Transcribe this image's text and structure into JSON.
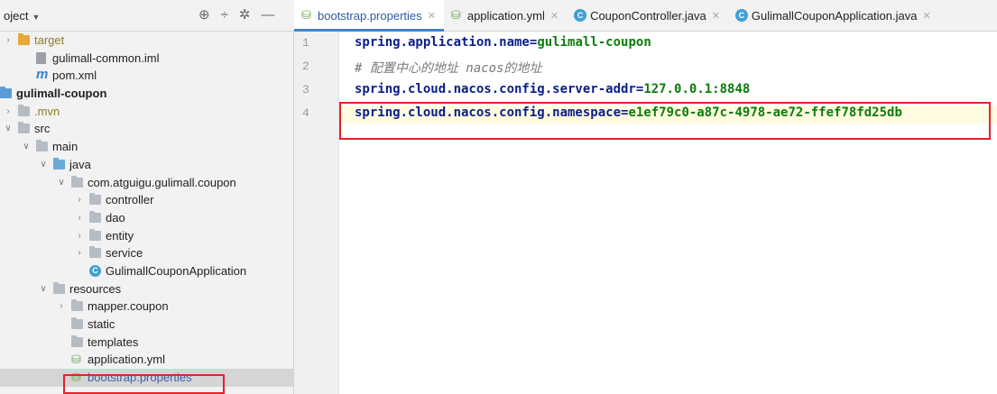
{
  "project_panel": {
    "title": "oject",
    "tree": [
      {
        "label": "target",
        "kind": "folder-orange",
        "depth": 0,
        "arrow": "right",
        "style": "olive"
      },
      {
        "label": "gulimall-common.iml",
        "kind": "iml",
        "depth": 1,
        "arrow": "",
        "style": ""
      },
      {
        "label": "pom.xml",
        "kind": "maven",
        "depth": 1,
        "arrow": "",
        "style": ""
      },
      {
        "label": "gulimall-coupon",
        "kind": "module",
        "depth": 0,
        "arrow": "",
        "style": "bold"
      },
      {
        "label": ".mvn",
        "kind": "folder-grey",
        "depth": 0,
        "arrow": "right",
        "style": "olive"
      },
      {
        "label": "src",
        "kind": "folder-grey",
        "depth": 0,
        "arrow": "down",
        "style": ""
      },
      {
        "label": "main",
        "kind": "folder-grey",
        "depth": 1,
        "arrow": "down",
        "style": ""
      },
      {
        "label": "java",
        "kind": "folder-blue",
        "depth": 2,
        "arrow": "down",
        "style": ""
      },
      {
        "label": "com.atguigu.gulimall.coupon",
        "kind": "folder-grey",
        "depth": 3,
        "arrow": "down",
        "style": ""
      },
      {
        "label": "controller",
        "kind": "folder-grey",
        "depth": 4,
        "arrow": "right",
        "style": ""
      },
      {
        "label": "dao",
        "kind": "folder-grey",
        "depth": 4,
        "arrow": "right",
        "style": ""
      },
      {
        "label": "entity",
        "kind": "folder-grey",
        "depth": 4,
        "arrow": "right",
        "style": ""
      },
      {
        "label": "service",
        "kind": "folder-grey",
        "depth": 4,
        "arrow": "right",
        "style": ""
      },
      {
        "label": "GulimallCouponApplication",
        "kind": "spring-class",
        "depth": 4,
        "arrow": "",
        "style": ""
      },
      {
        "label": "resources",
        "kind": "folder-grey",
        "depth": 2,
        "arrow": "down",
        "style": ""
      },
      {
        "label": "mapper.coupon",
        "kind": "folder-grey",
        "depth": 3,
        "arrow": "right",
        "style": ""
      },
      {
        "label": "static",
        "kind": "folder-grey",
        "depth": 3,
        "arrow": "",
        "style": ""
      },
      {
        "label": "templates",
        "kind": "folder-grey",
        "depth": 3,
        "arrow": "",
        "style": ""
      },
      {
        "label": "application.yml",
        "kind": "yml",
        "depth": 3,
        "arrow": "",
        "style": ""
      },
      {
        "label": "bootstrap.properties",
        "kind": "properties",
        "depth": 3,
        "arrow": "",
        "style": "blue",
        "selected": true
      }
    ]
  },
  "tabs": [
    {
      "label": "bootstrap.properties",
      "icon": "properties-icon",
      "active": true
    },
    {
      "label": "application.yml",
      "icon": "yml-icon",
      "active": false
    },
    {
      "label": "CouponController.java",
      "icon": "class-icon",
      "active": false
    },
    {
      "label": "GulimallCouponApplication.java",
      "icon": "spring-class-icon",
      "active": false
    }
  ],
  "editor": {
    "lines": [
      {
        "number": "1",
        "key": "spring.application.name",
        "eq": "=",
        "value": "gulimall-coupon",
        "comment": ""
      },
      {
        "number": "2",
        "key": "",
        "eq": "",
        "value": "",
        "comment": "# 配置中心的地址 nacos的地址"
      },
      {
        "number": "3",
        "key": "spring.cloud.nacos.config.server-addr",
        "eq": "=",
        "value": "127.0.0.1:8848",
        "comment": ""
      },
      {
        "number": "4",
        "key": "spring.cloud.nacos.config.namespace",
        "eq": "=",
        "value": "e1ef79c0-a87c-4978-ae72-ffef78fd25db",
        "comment": ""
      }
    ]
  },
  "colors": {
    "highlight_box": "#e0232e",
    "active_tab_underline": "#4083c9"
  }
}
